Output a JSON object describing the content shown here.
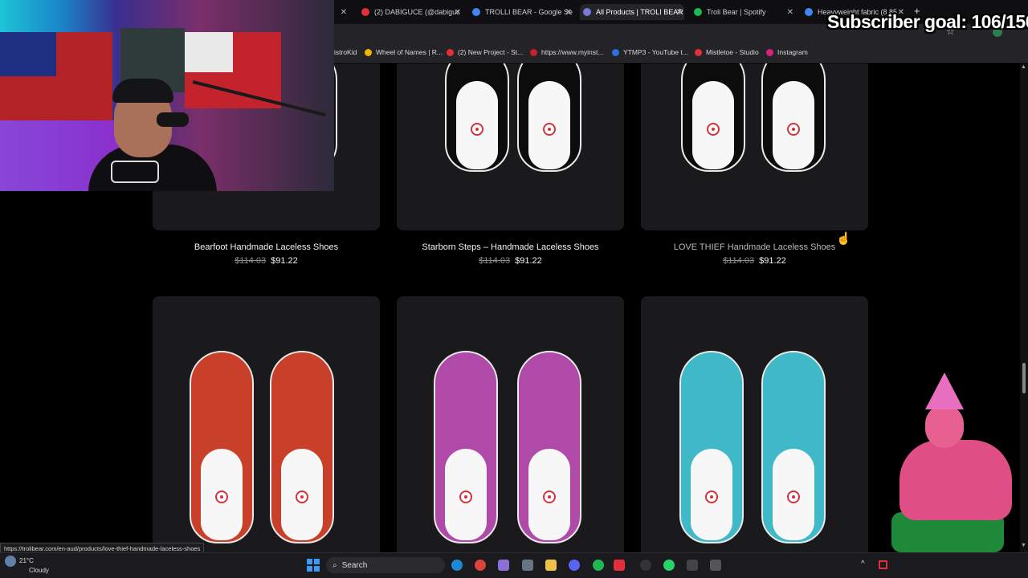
{
  "overlay": {
    "subscriber_goal": "Subscriber goal: 106/150"
  },
  "browser": {
    "tabs": [
      {
        "title": "(2) DABIGUCE (@dabiguc",
        "color": "#e2303a",
        "active": false
      },
      {
        "title": "TROLLI BEAR - Google Se",
        "color": "#4285f4",
        "active": false
      },
      {
        "title": "All Products | TROLI BEAR",
        "color": "#7a7ad8",
        "active": true
      },
      {
        "title": "Troli Bear | Spotify",
        "color": "#1db954",
        "active": false
      },
      {
        "title": "Heavyweight fabric (8.85",
        "color": "#4285f4",
        "active": false
      }
    ],
    "bookmarks": [
      {
        "label": "istroKid",
        "color": "#333333"
      },
      {
        "label": "Wheel of Names | R...",
        "color": "#f4b400"
      },
      {
        "label": "(2) New Project - St...",
        "color": "#e2303a"
      },
      {
        "label": "https://www.myinst...",
        "color": "#c2232c"
      },
      {
        "label": "YTMP3 - YouTube t...",
        "color": "#2f6fe0"
      },
      {
        "label": "Mistletoe - Studio",
        "color": "#e2303a"
      },
      {
        "label": "Instagram",
        "color": "#d6247d"
      }
    ],
    "status_url": "https://trolibear.com/en-aud/products/love-thief-handmade-laceless-shoes"
  },
  "products": [
    {
      "name": "Bearfoot Handmade Laceless Shoes",
      "old_price": "$114.03",
      "price": "$91.22",
      "accent": "#2a2a2a"
    },
    {
      "name": "Starborn Steps – Handmade Laceless Shoes",
      "old_price": "$114.03",
      "price": "$91.22",
      "accent": "#1fb5a8"
    },
    {
      "name": "LOVE THIEF Handmade Laceless Shoes",
      "old_price": "$114.03",
      "price": "$91.22",
      "accent": "#3a3a3a"
    },
    {
      "accent": "#c8402a"
    },
    {
      "accent": "#b04aa8"
    },
    {
      "accent": "#3fb8c8"
    }
  ],
  "taskbar": {
    "weather_temp": "21°C",
    "weather_desc": "Cloudy",
    "search_placeholder": "Search"
  }
}
